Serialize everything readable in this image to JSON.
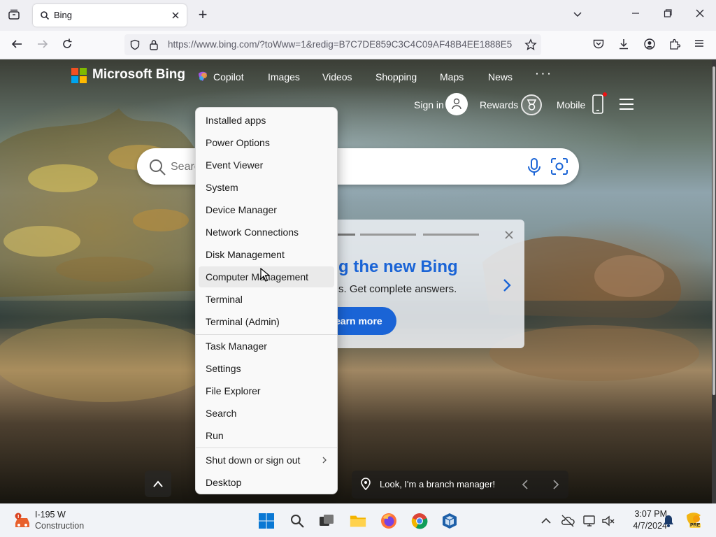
{
  "browser": {
    "tab_title": "Bing",
    "new_tab_symbol": "+",
    "url": "https://www.bing.com/?toWww=1&redig=B7C7DE859C3C4C09AF48B4EE1888E5"
  },
  "bing": {
    "logo_text": "Microsoft Bing",
    "nav": [
      "Copilot",
      "Images",
      "Videos",
      "Shopping",
      "Maps",
      "News"
    ],
    "more": "· · ·",
    "sign_in": "Sign in",
    "rewards": "Rewards",
    "mobile": "Mobile",
    "search_placeholder": "Search",
    "promo_title": "g the new Bing",
    "promo_sub": "s. Get complete answers.",
    "promo_button": "earn more",
    "location_caption": "Look, I'm a branch manager!"
  },
  "context_menu": {
    "group1": [
      "Installed apps",
      "Power Options",
      "Event Viewer",
      "System",
      "Device Manager",
      "Network Connections",
      "Disk Management",
      "Computer Management",
      "Terminal",
      "Terminal (Admin)"
    ],
    "group2": [
      "Task Manager",
      "Settings",
      "File Explorer",
      "Search",
      "Run"
    ],
    "group3": [
      "Shut down or sign out",
      "Desktop"
    ],
    "hovered": "Computer Management"
  },
  "taskbar": {
    "weather_title": "I-195 W",
    "weather_sub": "Construction",
    "time": "3:07 PM",
    "date": "4/7/2024",
    "pre_badge": "PRE"
  },
  "colors": {
    "bing_blue": "#1a64d6",
    "menu_bg": "#f9f9f9",
    "taskbar_bg": "#f1f3f7"
  }
}
